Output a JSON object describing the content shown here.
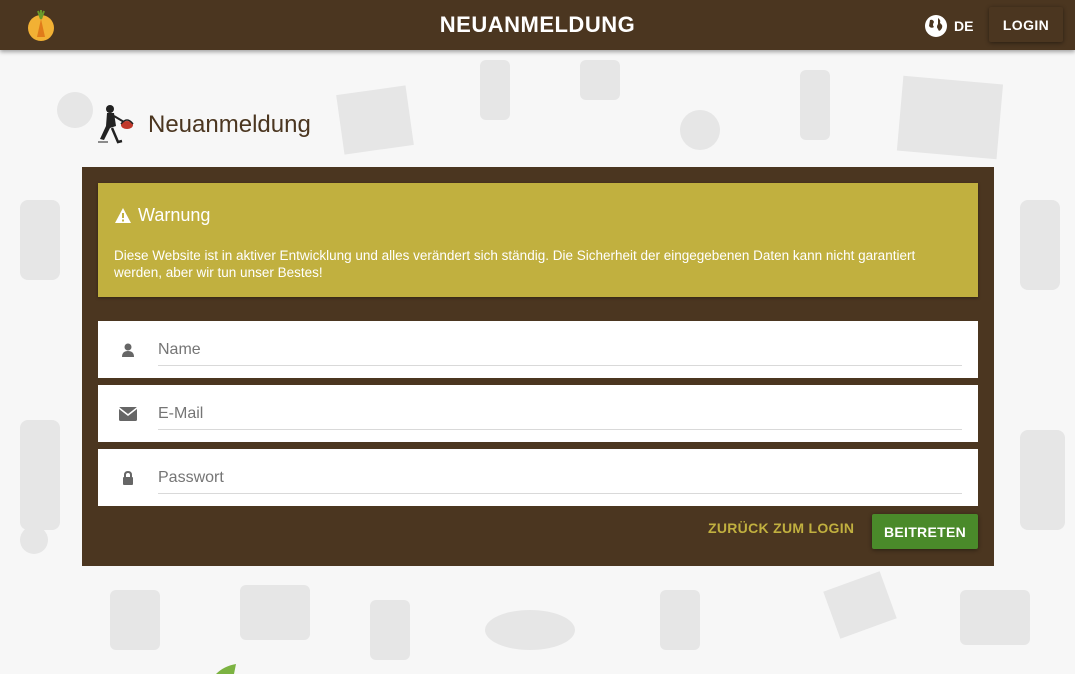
{
  "topbar": {
    "title": "NEUANMELDUNG",
    "language_label": "DE",
    "language_icon": "globe-icon",
    "login_label": "LOGIN",
    "logo_icon": "carrot-logo-icon"
  },
  "heading": {
    "text": "Neuanmeldung",
    "icon": "person-with-basket-icon"
  },
  "warning": {
    "icon": "warning-triangle-icon",
    "title": "Warnung",
    "text": "Diese Website ist in aktiver Entwicklung und alles verändert sich ständig. Die Sicherheit der eingegebenen Daten kann nicht garantiert werden, aber wir tun unser Bestes!"
  },
  "form": {
    "name": {
      "placeholder": "Name",
      "value": "",
      "icon": "user-icon"
    },
    "email": {
      "placeholder": "E-Mail",
      "value": "",
      "icon": "envelope-icon"
    },
    "password": {
      "placeholder": "Passwort",
      "value": "",
      "icon": "lock-icon"
    },
    "back_label": "ZURÜCK ZUM LOGIN",
    "join_label": "BEITRETEN"
  },
  "colors": {
    "brand_brown": "#4b3620",
    "warning_yellow": "#c1b03f",
    "join_green": "#4a8a2a",
    "background": "#f7f7f7"
  }
}
